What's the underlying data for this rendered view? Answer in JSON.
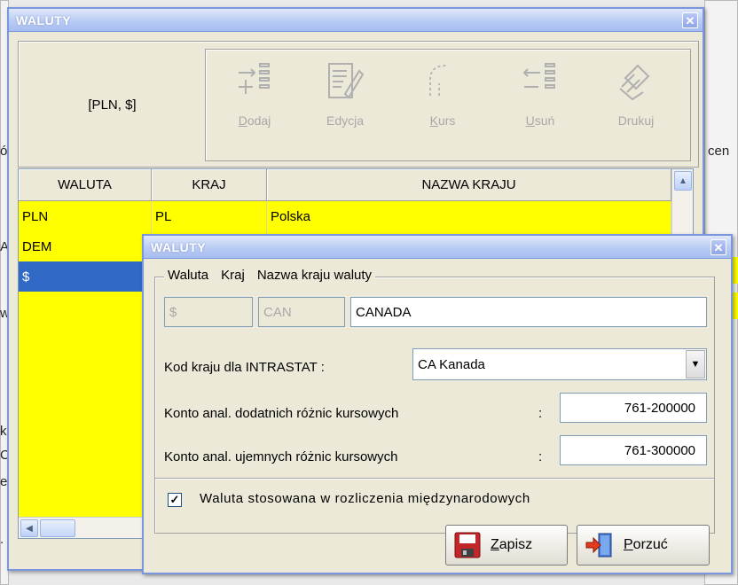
{
  "background": {
    "fragments": [
      "ó",
      "A",
      "w",
      "k",
      "C",
      "e",
      "."
    ],
    "right_label": "cen"
  },
  "main_window": {
    "title": "WALUTY",
    "current_selection": "[PLN, $]",
    "toolbar": {
      "add": "Dodaj",
      "edit": "Edycja",
      "rate": "Kurs",
      "delete": "Usuń",
      "print": "Drukuj"
    },
    "grid": {
      "columns": [
        "WALUTA",
        "KRAJ",
        "NAZWA KRAJU"
      ],
      "rows": [
        {
          "currency": "PLN",
          "country": "PL",
          "country_name": "Polska",
          "highlight": "yellow"
        },
        {
          "currency": "DEM",
          "country": "",
          "country_name": "",
          "highlight": "yellow"
        },
        {
          "currency": "$",
          "country": "",
          "country_name": "",
          "highlight": "selected"
        }
      ]
    }
  },
  "dialog": {
    "title": "WALUTY",
    "legend": {
      "currency": "Waluta",
      "country": "Kraj",
      "country_name": "Nazwa kraju waluty"
    },
    "fields": {
      "currency": "$",
      "country": "CAN",
      "country_name": "CANADA"
    },
    "intrastat": {
      "label": "Kod kraju dla INTRASTAT :",
      "value": "CA Kanada"
    },
    "positive_account": {
      "label": "Konto anal. dodatnich różnic kursowych",
      "colon": ":",
      "value": "761-200000"
    },
    "negative_account": {
      "label": "Konto anal. ujemnych różnic kursowych",
      "colon": ":",
      "value": "761-300000"
    },
    "international": {
      "label": "Waluta stosowana w rozliczenia międzynarodowych",
      "checked": true,
      "mark": "✓"
    },
    "buttons": {
      "save": "Zapisz",
      "abandon": "Porzuć"
    }
  },
  "icons": {
    "close": "close-icon",
    "dropdown": "chevron-down-icon",
    "save": "floppy-disk-icon",
    "abandon": "exit-door-icon"
  }
}
